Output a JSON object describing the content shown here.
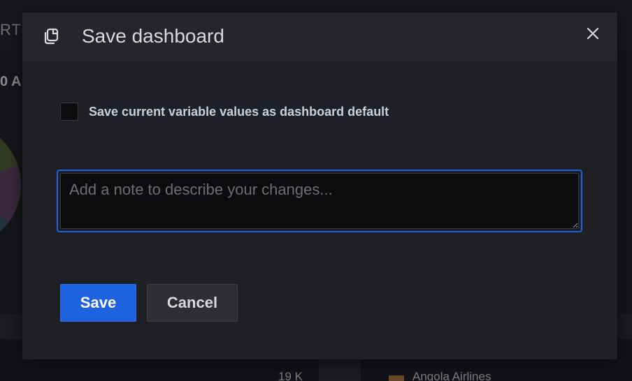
{
  "background": {
    "top_left_text": "RTE",
    "left_heading_text": "0 A",
    "bottom_value": "19 K",
    "legend_item": "Angola Airlines"
  },
  "modal": {
    "title": "Save dashboard",
    "header_icon": "copy-icon",
    "close_icon": "close-icon",
    "checkbox": {
      "label": "Save current variable values as dashboard default",
      "checked": false
    },
    "note": {
      "value": "",
      "placeholder": "Add a note to describe your changes..."
    },
    "buttons": {
      "save_label": "Save",
      "cancel_label": "Cancel"
    }
  },
  "colors": {
    "primary": "#1f62e0",
    "modal_bg": "#1f2025",
    "header_bg": "#24262b",
    "text": "#d8d9da"
  }
}
